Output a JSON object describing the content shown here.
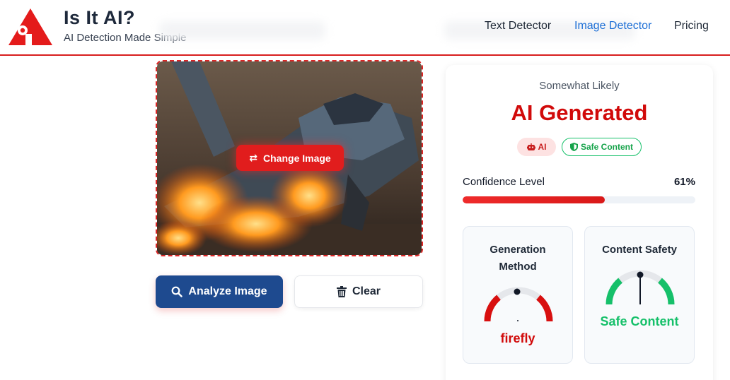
{
  "header": {
    "brand_title": "Is It AI?",
    "brand_tagline": "AI Detection Made Simple",
    "logo_icon": "red-triangle-logo-icon",
    "nav": [
      {
        "label": "Text Detector",
        "active": false
      },
      {
        "label": "Image Detector",
        "active": true
      },
      {
        "label": "Pricing",
        "active": false
      }
    ]
  },
  "upload": {
    "change_label": "Change Image",
    "change_icon": "swap-arrows-icon",
    "analyze_label": "Analyze Image",
    "analyze_icon": "search-icon",
    "clear_label": "Clear",
    "clear_icon": "trash-icon"
  },
  "result": {
    "likelihood": "Somewhat Likely",
    "verdict": "AI Generated",
    "badges": [
      {
        "label": "AI",
        "icon": "robot-icon"
      },
      {
        "label": "Safe Content",
        "icon": "shield-icon"
      }
    ],
    "confidence_label": "Confidence Level",
    "confidence_value": "61%",
    "confidence_fraction": 0.61,
    "generation": {
      "title_line1": "Generation",
      "title_line2": "Method",
      "value": "firefly"
    },
    "safety": {
      "title": "Content Safety",
      "value": "Safe Content"
    }
  },
  "colors": {
    "accent_red": "#d10a0a",
    "brand_blue": "#1e4a8f",
    "link_blue": "#1d6fd6",
    "safe_green": "#16c06a"
  }
}
